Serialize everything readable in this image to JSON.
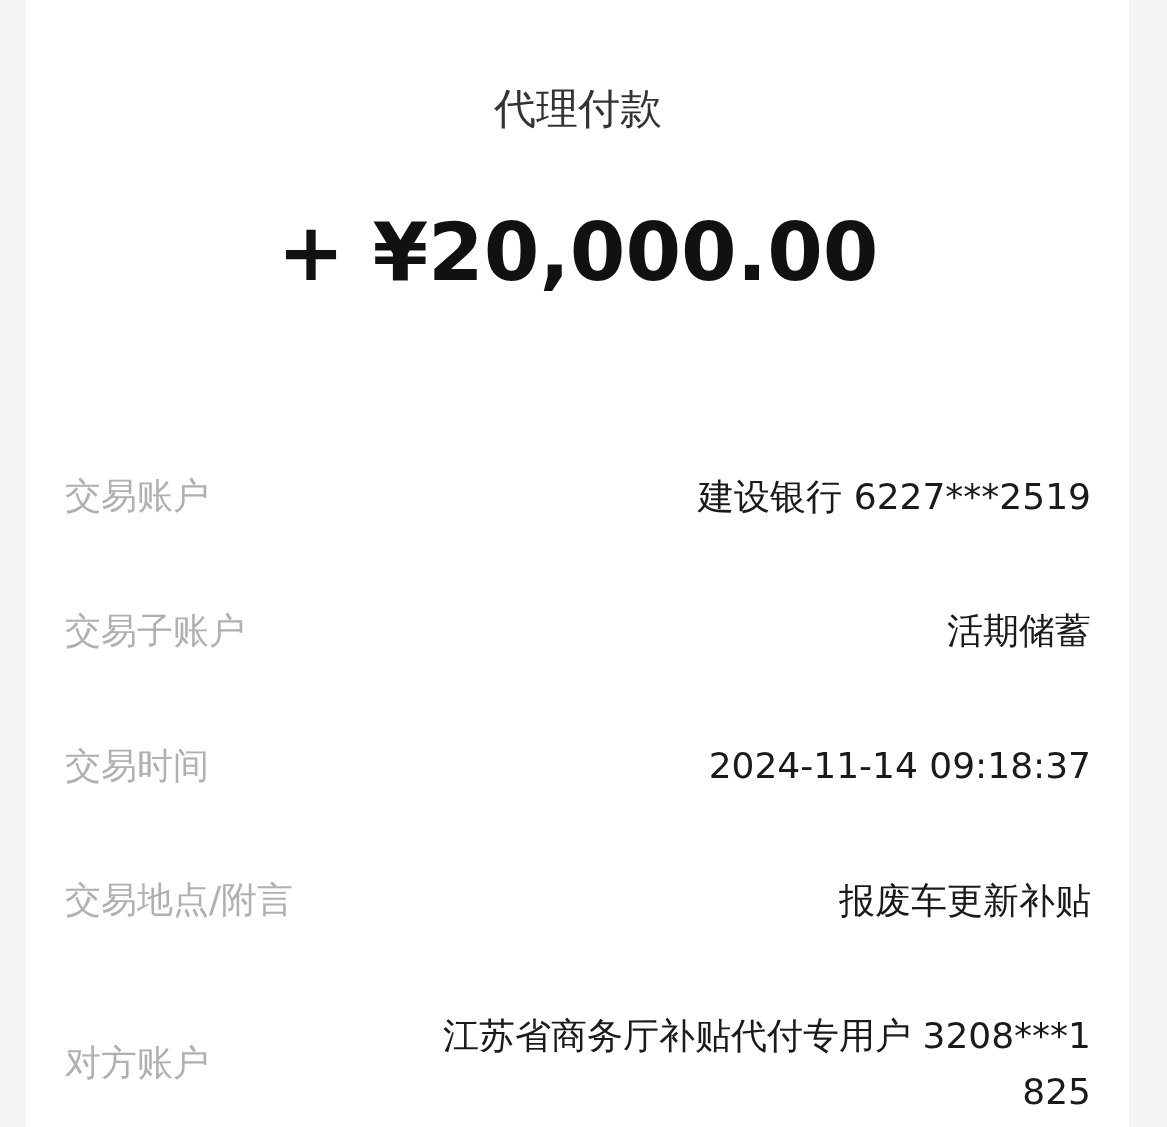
{
  "title": "代理付款",
  "amount": "+ ¥20,000.00",
  "details": [
    {
      "label": "交易账户",
      "value": "建设银行 6227***2519"
    },
    {
      "label": "交易子账户",
      "value": "活期储蓄"
    },
    {
      "label": "交易时间",
      "value": "2024-11-14 09:18:37"
    },
    {
      "label": "交易地点/附言",
      "value": "报废车更新补贴"
    },
    {
      "label": "对方账户",
      "value": "江苏省商务厅补贴代付专用户 3208***1825"
    }
  ]
}
